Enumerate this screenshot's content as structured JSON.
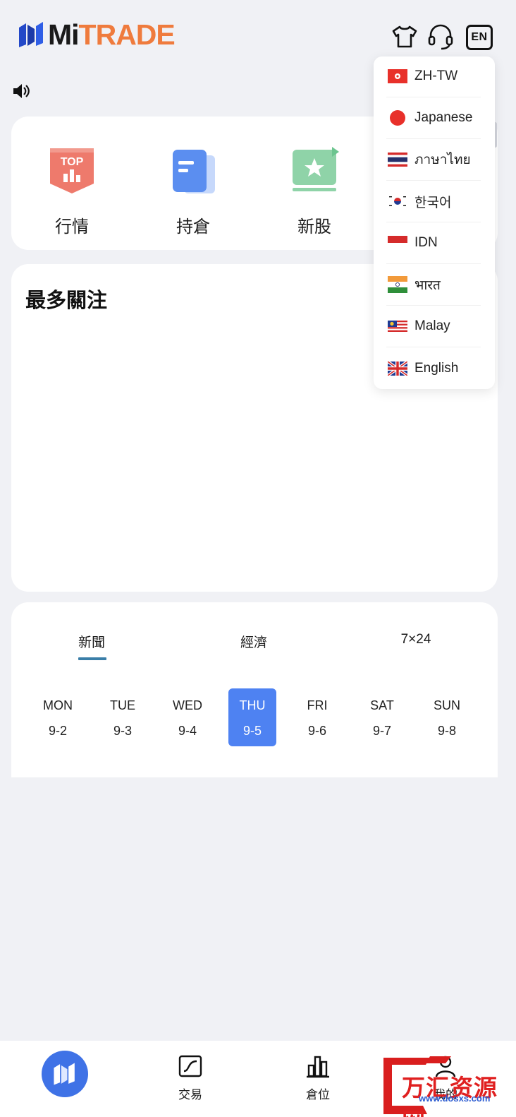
{
  "header": {
    "brand_mi": "Mi",
    "brand_trade": "TRADE",
    "brand_color": "#ef7b3d",
    "lang_button": "EN",
    "icons": [
      "shirt-icon",
      "headset-icon",
      "language-icon"
    ]
  },
  "quick_links": [
    {
      "label": "行情",
      "icon": "top-chart-icon",
      "badge": "TOP"
    },
    {
      "label": "持倉",
      "icon": "document-icon"
    },
    {
      "label": "新股",
      "icon": "star-screen-icon"
    }
  ],
  "focus": {
    "title": "最多關注"
  },
  "news": {
    "tabs": [
      "新聞",
      "經濟",
      "7×24"
    ],
    "active_tab": 0,
    "days": [
      {
        "name": "MON",
        "date": "9-2"
      },
      {
        "name": "TUE",
        "date": "9-3"
      },
      {
        "name": "WED",
        "date": "9-4"
      },
      {
        "name": "THU",
        "date": "9-5"
      },
      {
        "name": "FRI",
        "date": "9-6"
      },
      {
        "name": "SAT",
        "date": "9-7"
      },
      {
        "name": "SUN",
        "date": "9-8"
      }
    ],
    "active_day": 3,
    "accent_color": "#4e82f2"
  },
  "language_menu": {
    "items": [
      {
        "label": "ZH-TW",
        "flag": "hong-kong-flag-icon"
      },
      {
        "label": "Japanese",
        "flag": "japan-flag-icon"
      },
      {
        "label": "ภาษาไทย",
        "flag": "thailand-flag-icon"
      },
      {
        "label": "한국어",
        "flag": "korea-flag-icon"
      },
      {
        "label": "IDN",
        "flag": "indonesia-flag-icon"
      },
      {
        "label": "भारत",
        "flag": "india-flag-icon"
      },
      {
        "label": "Malay",
        "flag": "malaysia-flag-icon"
      },
      {
        "label": "English",
        "flag": "uk-flag-icon"
      }
    ]
  },
  "bottom_nav": {
    "items": [
      {
        "label": "",
        "icon": "home-logo-icon"
      },
      {
        "label": "交易",
        "icon": "trade-chart-icon"
      },
      {
        "label": "倉位",
        "icon": "position-bars-icon"
      },
      {
        "label": "我的",
        "icon": "profile-icon"
      }
    ]
  },
  "watermark": {
    "text": "万汇资源网",
    "url": "www.dosxs.com"
  }
}
